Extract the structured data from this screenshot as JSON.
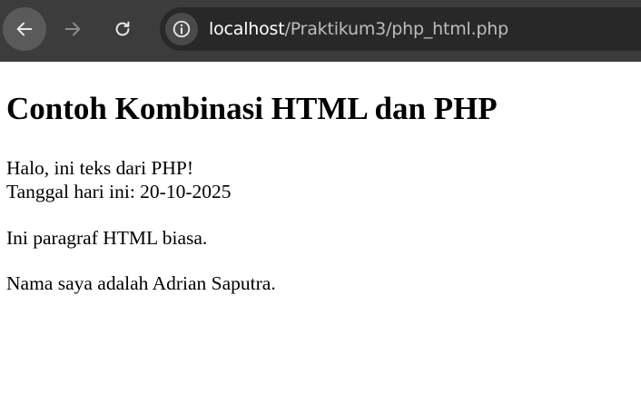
{
  "browser": {
    "url_host": "localhost",
    "url_path": "/Praktikum3/php_html.php",
    "icons": {
      "back": "arrow-left-icon",
      "forward": "arrow-right-icon",
      "reload": "reload-icon",
      "site_info": "info-icon"
    },
    "colors": {
      "toolbar": "#3c3c3c",
      "omnibox": "#282828"
    }
  },
  "page": {
    "heading": "Contoh Kombinasi HTML dan PHP",
    "php_text": "Halo, ini teks dari PHP!",
    "date_line": "Tanggal hari ini: 20-10-2025",
    "html_paragraph": "Ini paragraf HTML biasa.",
    "name_paragraph": "Nama saya adalah Adrian Saputra."
  }
}
